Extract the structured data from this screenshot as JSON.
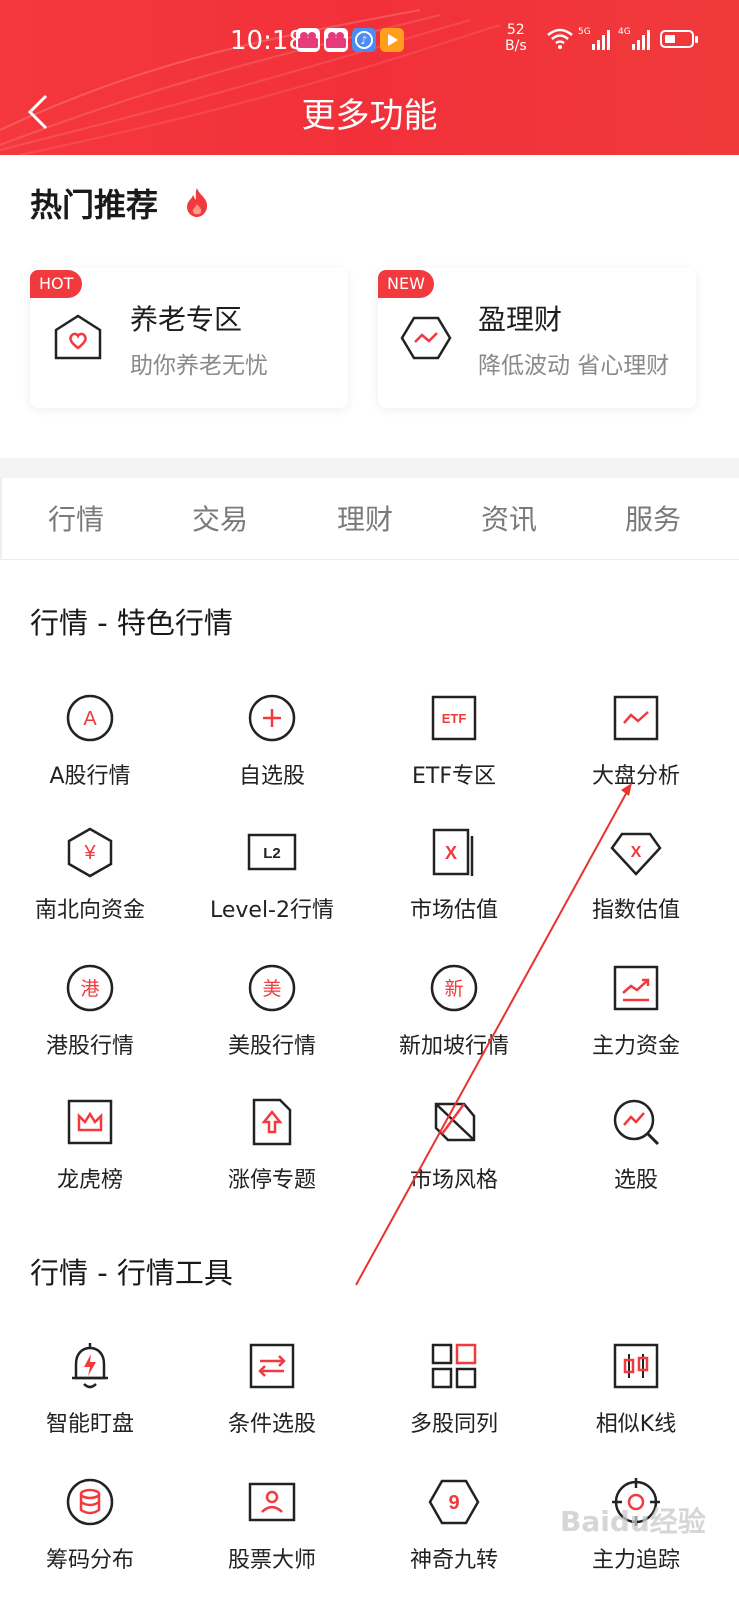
{
  "status": {
    "time": "10:18",
    "speed": "52",
    "speed_unit": "B/s",
    "sig1": "5G",
    "sig2": "4G"
  },
  "nav": {
    "title": "更多功能"
  },
  "hot": {
    "title": "热门推荐",
    "cards": [
      {
        "badge": "HOT",
        "title": "养老专区",
        "subtitle": "助你养老无忧"
      },
      {
        "badge": "NEW",
        "title": "盈理财",
        "subtitle": "降低波动 省心理财"
      }
    ]
  },
  "tabs": [
    "行情",
    "交易",
    "理财",
    "资讯",
    "服务"
  ],
  "sections": [
    {
      "title": "行情 - 特色行情",
      "items": [
        "A股行情",
        "自选股",
        "ETF专区",
        "大盘分析",
        "南北向资金",
        "Level-2行情",
        "市场估值",
        "指数估值",
        "港股行情",
        "美股行情",
        "新加坡行情",
        "主力资金",
        "龙虎榜",
        "涨停专题",
        "市场风格",
        "选股"
      ]
    },
    {
      "title": "行情 - 行情工具",
      "items": [
        "智能盯盘",
        "条件选股",
        "多股同列",
        "相似K线",
        "筹码分布",
        "股票大师",
        "神奇九转",
        "主力追踪"
      ]
    }
  ],
  "icon_glyphs": {
    "a_stock": "A",
    "etf": "ETF",
    "yen": "¥",
    "l2": "L2",
    "x": "X",
    "hk": "港",
    "us": "美",
    "sg": "新",
    "nine": "9"
  },
  "watermark": "Baidu经验",
  "colors": {
    "accent": "#f23a3e",
    "header": "#f2353c",
    "text": "#222222",
    "muted": "#8a8a8a"
  }
}
